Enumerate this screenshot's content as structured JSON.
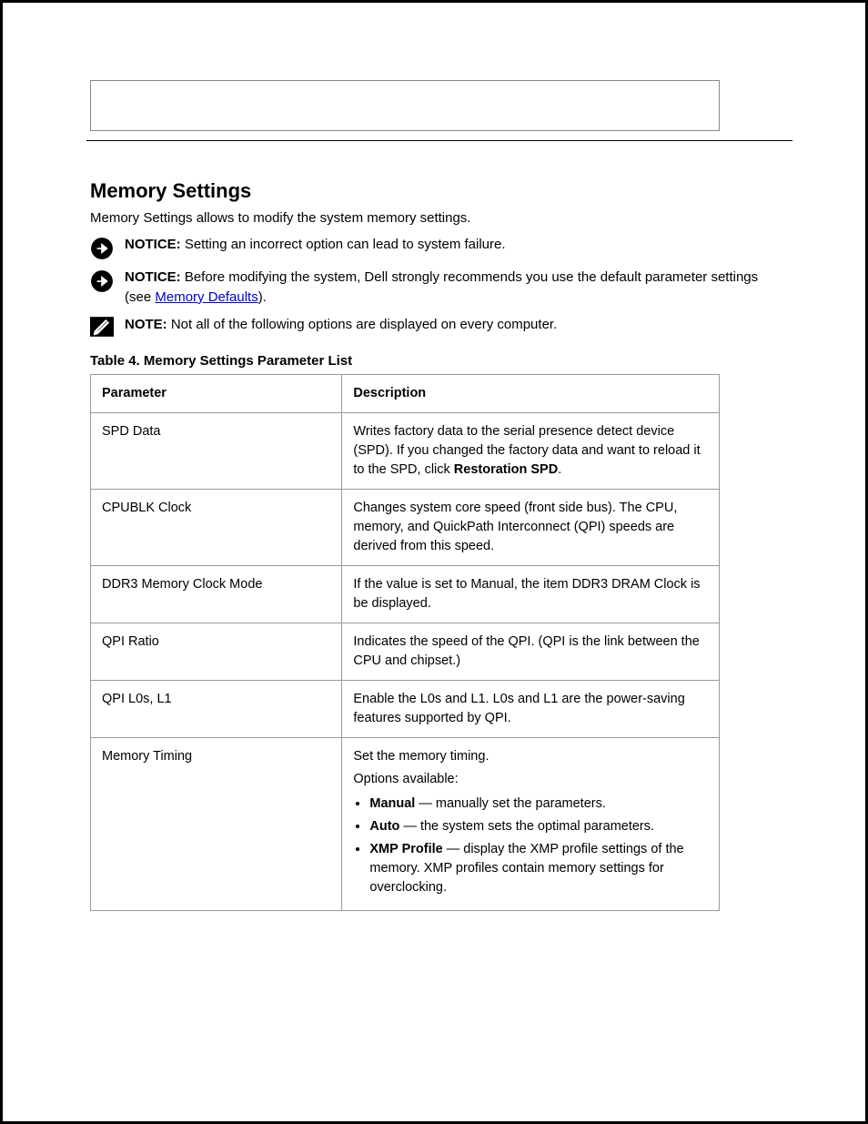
{
  "section_title": "Memory Settings",
  "intro": "Memory Settings allows to modify the system memory settings.",
  "notice1": {
    "label": "NOTICE:",
    "text": " Setting an incorrect option can lead to system failure."
  },
  "notice2": {
    "label": "NOTICE:",
    "text_before": " Before modifying the system, Dell strongly recommends you use the default parameter settings (see ",
    "link_text": "Memory Defaults",
    "text_after": ")."
  },
  "note": {
    "label": "NOTE:",
    "text": " Not all of the following options are displayed on every computer."
  },
  "table_title": "Table 4. Memory Settings Parameter List",
  "table_headers": {
    "param": "Parameter",
    "desc": "Description"
  },
  "rows": [
    {
      "param": "SPD Data",
      "desc_pre": "Writes factory data to the serial presence detect device (SPD). If you changed the factory data and want to reload it to the SPD, click ",
      "desc_bold": "Restoration SPD",
      "desc_post": "."
    },
    {
      "param": "CPUBLK Clock",
      "desc": "Changes system core speed (front side bus). The CPU, memory, and QuickPath Interconnect (QPI) speeds are derived from this speed."
    },
    {
      "param": "DDR3 Memory Clock Mode",
      "desc": "If the value is set to Manual, the item DDR3 DRAM Clock is be displayed."
    },
    {
      "param": "QPI Ratio",
      "desc": "Indicates the speed of the QPI. (QPI is the link between the CPU and chipset.)"
    },
    {
      "param": "QPI L0s, L1",
      "desc": "Enable the L0s and L1. L0s and L1 are the power-saving features supported by QPI."
    },
    {
      "param": "Memory Timing",
      "desc_intro": "Set the memory timing.",
      "options_label": "Options available:",
      "options": [
        {
          "bold": "Manual",
          "rest": " — manually set the parameters."
        },
        {
          "bold": "Auto",
          "rest": " — the system sets the optimal parameters."
        },
        {
          "bold": "XMP Profile",
          "rest": " — display the XMP profile settings of the memory. XMP profiles contain memory settings for overclocking."
        }
      ]
    }
  ]
}
